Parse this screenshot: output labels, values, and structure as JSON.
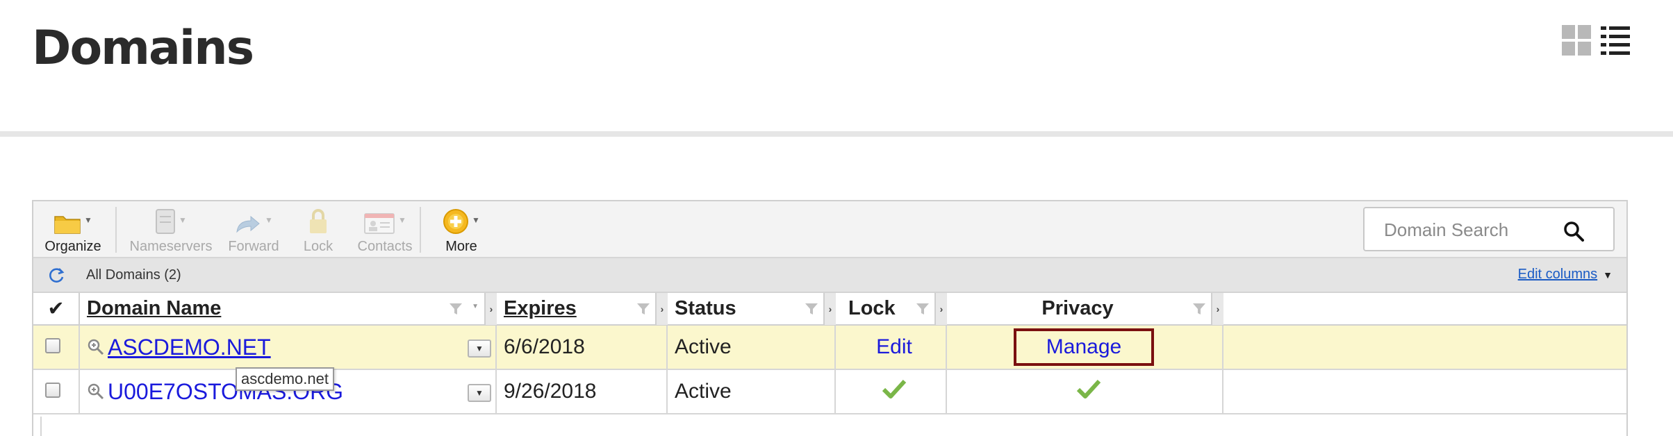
{
  "header": {
    "title": "Domains"
  },
  "toolbar": {
    "organize": "Organize",
    "nameservers": "Nameservers",
    "forward": "Forward",
    "lock": "Lock",
    "contacts": "Contacts",
    "more": "More"
  },
  "search": {
    "placeholder": "Domain Search"
  },
  "subbar": {
    "all_domains": "All Domains (2)",
    "edit_columns": "Edit columns"
  },
  "columns": [
    "Domain Name",
    "Expires",
    "Status",
    "Lock",
    "Privacy"
  ],
  "rows": [
    {
      "domain": "ASCDEMO.NET",
      "expires": "6/6/2018",
      "status": "Active",
      "lock": "Edit",
      "privacy": "Manage"
    },
    {
      "domain": "U00E7OSTOMAS.ORG",
      "expires": "9/26/2018",
      "status": "Active",
      "lock": "check-icon",
      "privacy": "check-icon"
    }
  ],
  "tooltip": "ascdemo.net",
  "colors": {
    "link": "#1a1adc",
    "highlight": "#fbf7cd",
    "check": "#7ab648",
    "manage_border": "#7a1010"
  }
}
